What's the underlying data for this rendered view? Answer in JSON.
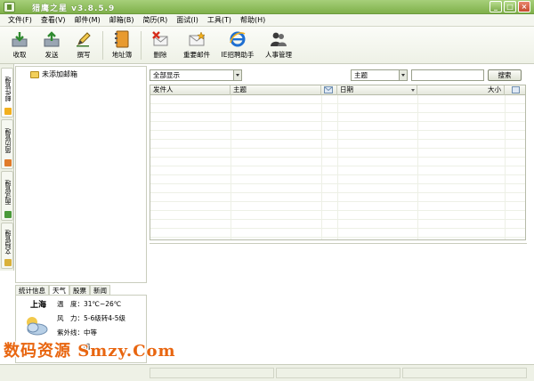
{
  "window": {
    "title": "猎鹰之星 v3.8.5.9",
    "buttons": [
      "_",
      "□",
      "×"
    ]
  },
  "menu": [
    "文件(F)",
    "查看(V)",
    "邮件(M)",
    "邮箱(B)",
    "简历(R)",
    "面试(I)",
    "工具(T)",
    "帮助(H)"
  ],
  "toolbar": {
    "receive": "收取",
    "send": "发送",
    "compose": "撰写",
    "address_book": "地址簿",
    "delete": "删除",
    "important_mail": "重要邮件",
    "ie_helper": "IE招聘助手",
    "hr_management": "人事管理"
  },
  "side_tabs": {
    "mail": "邮件管理",
    "resume": "简历管理",
    "interview": "面试管理",
    "document": "文档管理"
  },
  "tree": {
    "folder_label": "未添加邮箱"
  },
  "bottom_tabs": [
    "统计信息",
    "天气",
    "股票",
    "新闻"
  ],
  "weather": {
    "city": "上海",
    "temp_label": "温　度：",
    "temp_value": "31℃~26℃",
    "wind_label": "风　力：",
    "wind_value": "5-6级转4-5级",
    "uv_label": "紫外线：",
    "uv_value": "中等",
    "extra_value": "晴"
  },
  "filter": {
    "show_select": "全部显示",
    "field_select": "主题",
    "search_value": "",
    "search_button": "搜索"
  },
  "table": {
    "headers": {
      "sender": "发件人",
      "subject": "主题",
      "date": "日期",
      "size": "大小"
    }
  },
  "watermark": "数码资源 Smzy.Com",
  "colors": {
    "titlebar": "#8fbf5c",
    "accent": "#e8650f"
  }
}
